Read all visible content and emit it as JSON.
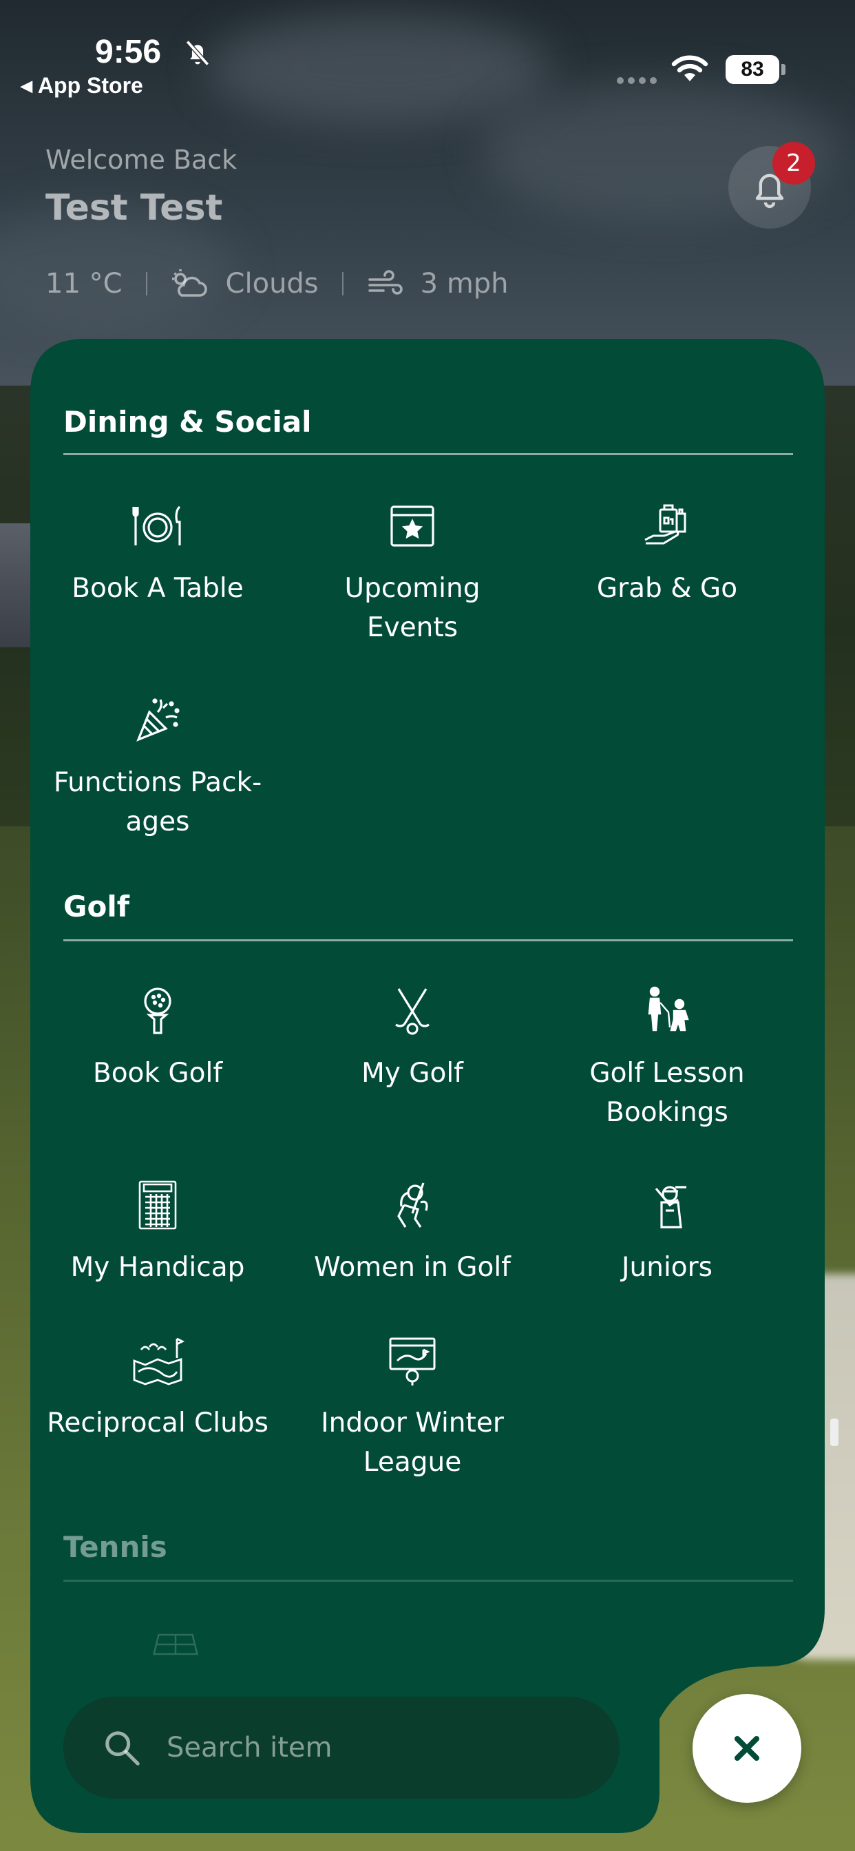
{
  "status_bar": {
    "time": "9:56",
    "back_label": "App Store",
    "battery": "83"
  },
  "header": {
    "welcome": "Welcome Back",
    "user_name": "Test Test",
    "notification_count": "2"
  },
  "weather": {
    "temperature": "11 °C",
    "condition": "Clouds",
    "wind": "3 mph"
  },
  "sections": {
    "dining": {
      "title": "Dining & Social",
      "items": [
        {
          "label": "Book A Table",
          "icon": "plate-cutlery-icon"
        },
        {
          "label": "Upcoming Events",
          "icon": "calendar-star-icon"
        },
        {
          "label": "Grab & Go",
          "icon": "takeaway-bag-icon"
        },
        {
          "label": "Functions Pack-ages",
          "icon": "party-popper-icon"
        }
      ]
    },
    "golf": {
      "title": "Golf",
      "items": [
        {
          "label": "Book Golf",
          "icon": "golf-ball-tee-icon"
        },
        {
          "label": "My Golf",
          "icon": "crossed-clubs-icon"
        },
        {
          "label": "Golf Lesson Bookings",
          "icon": "golf-lesson-icon"
        },
        {
          "label": "My Handicap",
          "icon": "scorecard-icon"
        },
        {
          "label": "Women in Golf",
          "icon": "woman-golfer-icon"
        },
        {
          "label": "Juniors",
          "icon": "junior-golfer-icon"
        },
        {
          "label": "Reciprocal Clubs",
          "icon": "golf-course-map-icon"
        },
        {
          "label": "Indoor Winter League",
          "icon": "indoor-simulator-icon"
        }
      ]
    },
    "tennis": {
      "title": "Tennis"
    }
  },
  "search": {
    "placeholder": "Search item"
  },
  "colors": {
    "panel": "#014b37",
    "search_bg": "#0a3d2c",
    "badge": "#c7202c",
    "close_icon": "#014b37"
  }
}
